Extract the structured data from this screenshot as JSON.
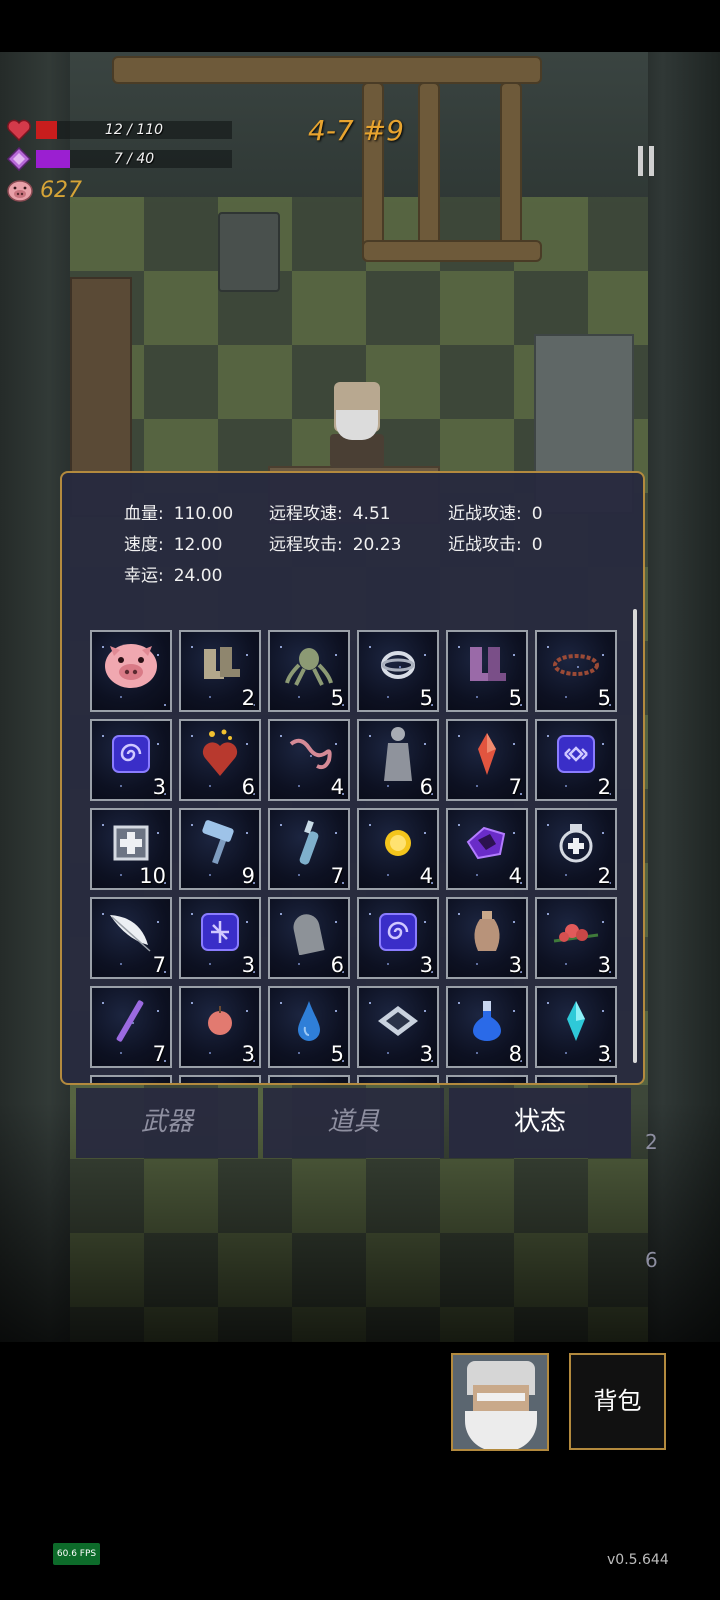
{
  "hud": {
    "health_text": "12 / 110",
    "health_fraction": 0.109,
    "mana_text": "7 / 40",
    "mana_fraction": 0.175,
    "coins": "627",
    "level": "4-7 #9",
    "colors": {
      "health": "#c81d1d",
      "mana": "#9b1fd1",
      "coins": "#d6a437",
      "level": "#e8a42f"
    },
    "icons": {
      "health": "heart-icon",
      "mana": "gem-icon",
      "coins": "piggy-bank-icon",
      "pause": "pause-icon"
    }
  },
  "stats": [
    {
      "label": "血量:",
      "value": "110.00"
    },
    {
      "label": "远程攻速:",
      "value": "4.51"
    },
    {
      "label": "近战攻速:",
      "value": "0"
    },
    {
      "label": "速度:",
      "value": "12.00"
    },
    {
      "label": "远程攻击:",
      "value": "20.23"
    },
    {
      "label": "近战攻击:",
      "value": "0"
    },
    {
      "label": "幸运:",
      "value": "24.00"
    }
  ],
  "items": [
    {
      "icon": "piggy-bank-icon",
      "count": ""
    },
    {
      "icon": "boots-pair-icon",
      "count": "2"
    },
    {
      "icon": "octopus-icon",
      "count": "5"
    },
    {
      "icon": "ring-icon",
      "count": "5"
    },
    {
      "icon": "purple-boots-icon",
      "count": "5"
    },
    {
      "icon": "thorn-crown-icon",
      "count": "5"
    },
    {
      "icon": "spiral-rune-icon",
      "count": "3"
    },
    {
      "icon": "burning-heart-icon",
      "count": "6"
    },
    {
      "icon": "worm-icon",
      "count": "4"
    },
    {
      "icon": "statue-icon",
      "count": "6"
    },
    {
      "icon": "red-crystal-icon",
      "count": "7"
    },
    {
      "icon": "eye-rune-icon",
      "count": "2"
    },
    {
      "icon": "medkit-icon",
      "count": "10"
    },
    {
      "icon": "hammer-icon",
      "count": "9"
    },
    {
      "icon": "bottle-icon",
      "count": "7"
    },
    {
      "icon": "gold-coin-icon",
      "count": "4"
    },
    {
      "icon": "purple-gem-icon",
      "count": "4"
    },
    {
      "icon": "medal-icon",
      "count": "2"
    },
    {
      "icon": "feather-icon",
      "count": "7"
    },
    {
      "icon": "cross-rune-icon",
      "count": "3"
    },
    {
      "icon": "tombstone-icon",
      "count": "6"
    },
    {
      "icon": "spiral-rune-icon",
      "count": "3"
    },
    {
      "icon": "vase-icon",
      "count": "3"
    },
    {
      "icon": "rose-icon",
      "count": "3"
    },
    {
      "icon": "wand-icon",
      "count": "7"
    },
    {
      "icon": "apple-icon",
      "count": "3"
    },
    {
      "icon": "water-drop-icon",
      "count": "5"
    },
    {
      "icon": "diamond-plate-icon",
      "count": "3"
    },
    {
      "icon": "blue-potion-icon",
      "count": "8"
    },
    {
      "icon": "cyan-crystal-icon",
      "count": "3"
    }
  ],
  "tabs": [
    {
      "label": "武器",
      "active": false
    },
    {
      "label": "道具",
      "active": false
    },
    {
      "label": "状态",
      "active": true
    }
  ],
  "side_counts": {
    "first": "2",
    "second": "6"
  },
  "bag_label": "背包",
  "fps": "60.6 FPS",
  "version": "v0.5.644"
}
